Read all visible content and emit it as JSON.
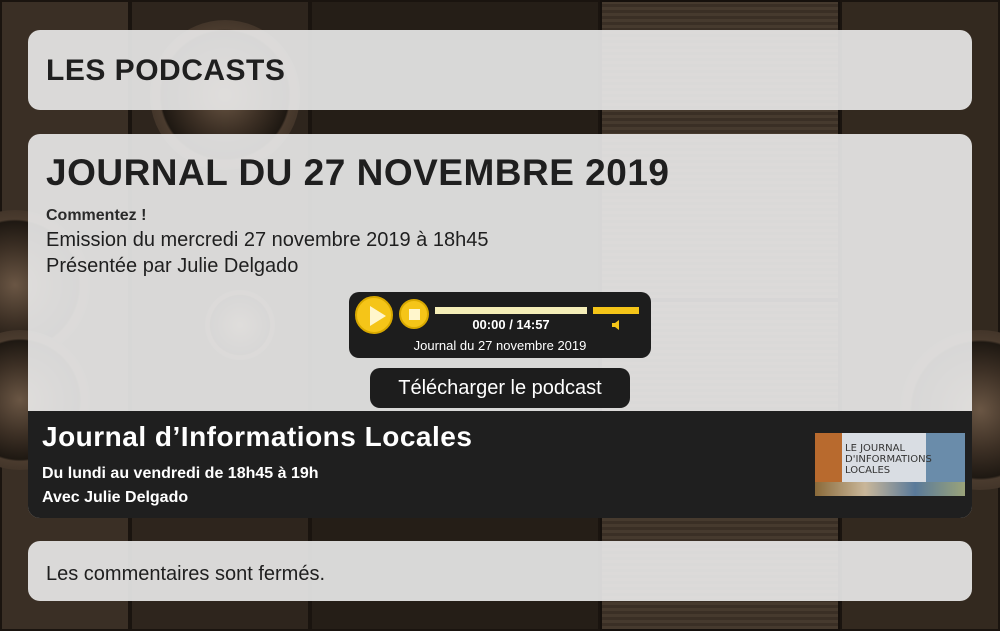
{
  "page": {
    "title": "LES PODCASTS"
  },
  "episode": {
    "title": "JOURNAL DU 27 NOVEMBRE 2019",
    "comment_link": "Commentez !",
    "broadcast": "Emission du mercredi 27 novembre 2019 à 18h45",
    "presenter": "Présentée par Julie Delgado"
  },
  "player": {
    "time": "00:00 / 14:57",
    "track_title": "Journal du 27 novembre 2019",
    "progress": 0,
    "volume": 1,
    "icons": {
      "play": "play-icon",
      "stop": "stop-icon",
      "volume": "speaker-icon"
    },
    "accent_color": "#f5c518"
  },
  "download": {
    "label": "Télécharger le podcast"
  },
  "show": {
    "title": "Journal d’Informations Locales",
    "schedule": "Du lundi au vendredi de 18h45 à 19h",
    "host": "Avec Julie Delgado",
    "logo_text": "LE JOURNAL D'INFORMATIONS LOCALES"
  },
  "comments": {
    "status": "Les commentaires sont fermés."
  }
}
